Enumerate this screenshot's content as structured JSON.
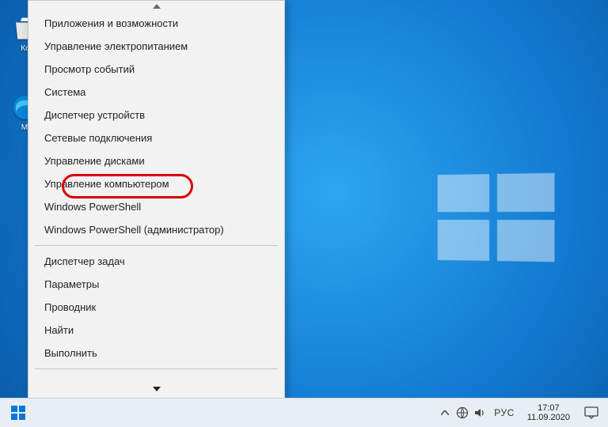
{
  "desktop": {
    "icons": [
      {
        "label": "Ко"
      },
      {
        "label": "Mi"
      }
    ]
  },
  "winx_menu": {
    "group1": [
      "Приложения и возможности",
      "Управление электропитанием",
      "Просмотр событий",
      "Система",
      "Диспетчер устройств",
      "Сетевые подключения",
      "Управление дисками",
      "Управление компьютером",
      "Windows PowerShell",
      "Windows PowerShell (администратор)"
    ],
    "group2": [
      "Диспетчер задач",
      "Параметры",
      "Проводник",
      "Найти",
      "Выполнить"
    ],
    "highlighted_index": 6
  },
  "tray": {
    "lang": "РУС",
    "time": "17:07",
    "date": "11.09.2020"
  }
}
